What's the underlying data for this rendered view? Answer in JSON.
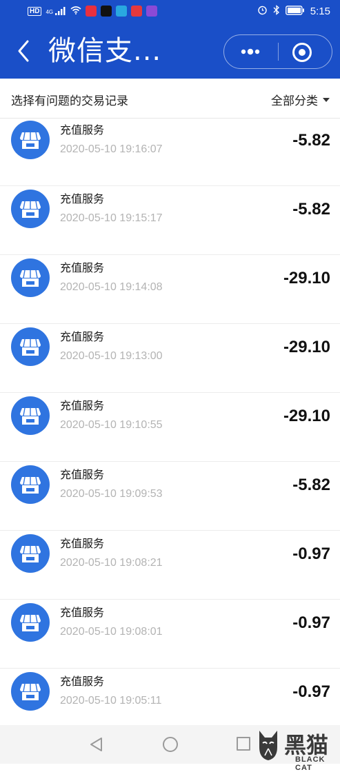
{
  "status_bar": {
    "left_icons": [
      "hd-icon",
      "4g-signal-icon",
      "wifi-icon",
      "app-icon-red",
      "tiktok-icon",
      "app-icon-blue",
      "app-icon-red2",
      "app-icon-purple"
    ],
    "hd": "HD",
    "network": "4G",
    "time": "5:15",
    "right_icons": [
      "alarm-icon",
      "bluetooth-icon",
      "battery-icon"
    ]
  },
  "header": {
    "title": "微信支...",
    "back_icon": "chevron-left-icon",
    "more_icon": "more-dots-icon",
    "close_icon": "target-circle-icon"
  },
  "filter": {
    "label": "选择有问题的交易记录",
    "category": "全部分类",
    "category_icon": "caret-down-icon"
  },
  "transactions": [
    {
      "title": "充值服务",
      "time": "2020-05-10 19:16:07",
      "amount": "-5.82"
    },
    {
      "title": "充值服务",
      "time": "2020-05-10 19:15:17",
      "amount": "-5.82"
    },
    {
      "title": "充值服务",
      "time": "2020-05-10 19:14:08",
      "amount": "-29.10"
    },
    {
      "title": "充值服务",
      "time": "2020-05-10 19:13:00",
      "amount": "-29.10"
    },
    {
      "title": "充值服务",
      "time": "2020-05-10 19:10:55",
      "amount": "-29.10"
    },
    {
      "title": "充值服务",
      "time": "2020-05-10 19:09:53",
      "amount": "-5.82"
    },
    {
      "title": "充值服务",
      "time": "2020-05-10 19:08:21",
      "amount": "-0.97"
    },
    {
      "title": "充值服务",
      "time": "2020-05-10 19:08:01",
      "amount": "-0.97"
    },
    {
      "title": "充值服务",
      "time": "2020-05-10 19:05:11",
      "amount": "-0.97"
    }
  ],
  "nav_bar": {
    "icons": [
      "nav-back-icon",
      "nav-home-icon",
      "nav-recent-icon"
    ]
  },
  "watermark": {
    "logo": "black-cat-logo",
    "text": "黑猫",
    "sub": "BLACK CAT"
  },
  "colors": {
    "header_bg": "#1a4fc8",
    "avatar_bg": "#2f74e0",
    "time_text": "#b3b3b3"
  }
}
